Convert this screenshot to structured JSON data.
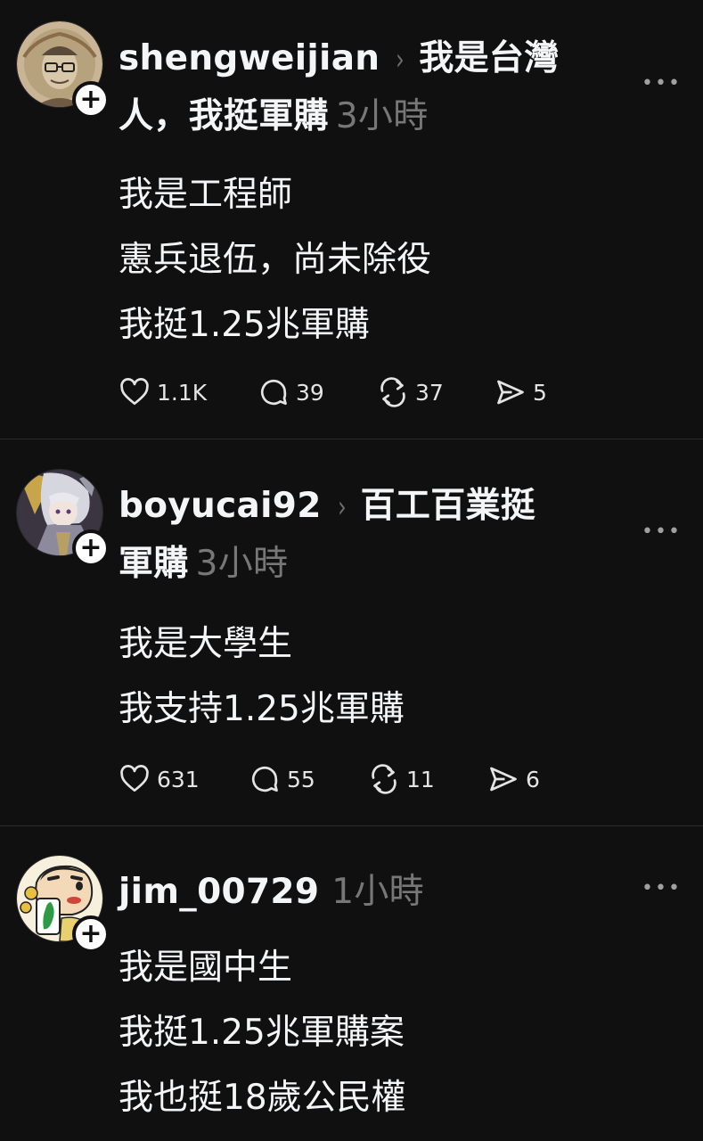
{
  "posts": [
    {
      "username": "shengweijian",
      "topic_line1": "我是台灣",
      "topic_line2": "人，我挺軍購",
      "time": "3小時",
      "body": [
        "我是工程師",
        "憲兵退伍，尚未除役",
        "我挺1.25兆軍購"
      ],
      "likes": "1.1K",
      "replies": "39",
      "reposts": "37",
      "shares": "5",
      "avatar_icon": "man-with-glasses-avatar"
    },
    {
      "username": "boyucai92",
      "topic_line1": "百工百業挺",
      "topic_line2": "軍購",
      "time": "3小時",
      "body": [
        "我是大學生",
        "我支持1.25兆軍購"
      ],
      "likes": "631",
      "replies": "55",
      "reposts": "11",
      "shares": "6",
      "avatar_icon": "anime-character-avatar"
    },
    {
      "username": "jim_00729",
      "time": "1小時",
      "body": [
        "我是國中生",
        "我挺1.25兆軍購案",
        "我也挺18歲公民權"
      ],
      "avatar_icon": "cartoon-boy-taiwan-avatar"
    }
  ],
  "ui": {
    "follow_glyph": "+",
    "more_glyph": "•••",
    "chevron_glyph": "›"
  },
  "colors": {
    "background": "#101010",
    "text": "#f3f5f7",
    "muted": "#777777",
    "divider": "#2c2c2c"
  }
}
